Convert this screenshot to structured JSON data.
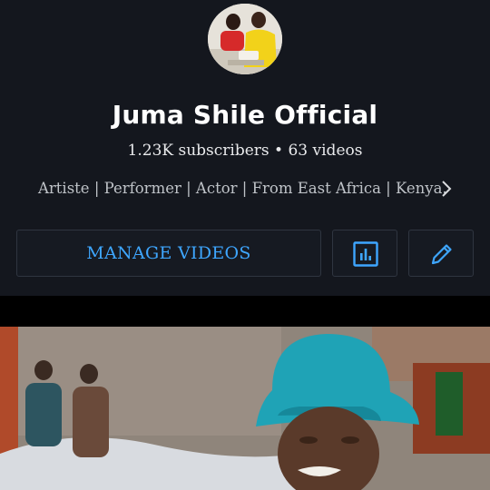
{
  "channel": {
    "name": "Juma Shile Official",
    "stats": "1.23K subscribers • 63 videos",
    "about": "Artiste | Performer | Actor | From East Africa | Kenya.",
    "about_more_icon": "chevron-right-icon",
    "avatar_icon": "channel-avatar"
  },
  "actions": {
    "manage_label": "MANAGE VIDEOS",
    "analytics_icon": "analytics-icon",
    "edit_icon": "pencil-icon"
  },
  "colors": {
    "header_bg": "#14171e",
    "accent": "#3ea6ff",
    "text_primary": "#ffffff",
    "text_secondary": "#bfc3c8"
  }
}
